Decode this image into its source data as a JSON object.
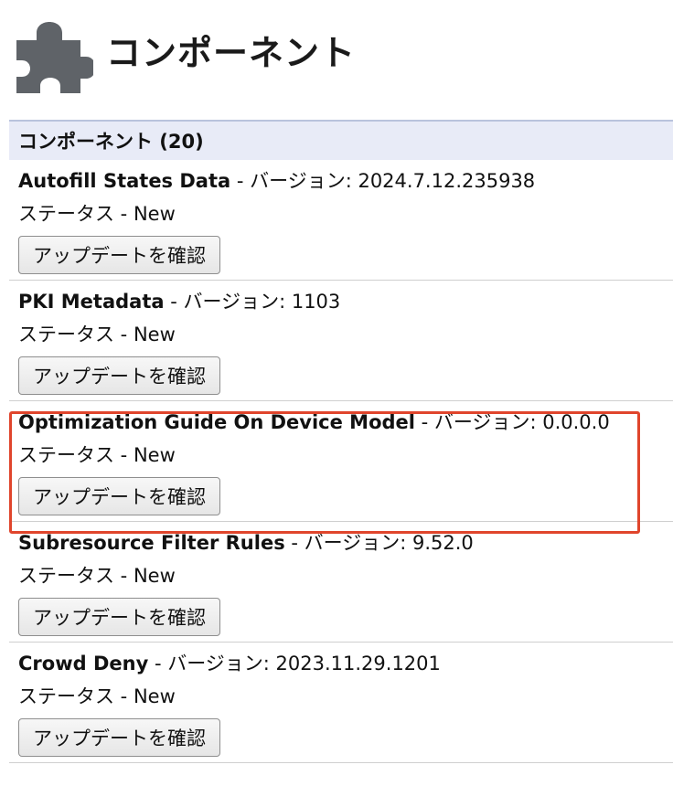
{
  "page": {
    "title": "コンポーネント",
    "icon": "puzzle-piece-icon"
  },
  "section": {
    "header": "コンポーネント (20)"
  },
  "labels": {
    "version_prefix": " - バージョン: ",
    "status_prefix": "ステータス - ",
    "check_button": "アップデートを確認"
  },
  "components": [
    {
      "name": "Autofill States Data",
      "version": "2024.7.12.235938",
      "status": "New"
    },
    {
      "name": "PKI Metadata",
      "version": "1103",
      "status": "New"
    },
    {
      "name": "Optimization Guide On Device Model",
      "version": "0.0.0.0",
      "status": "New",
      "highlighted": true
    },
    {
      "name": "Subresource Filter Rules",
      "version": "9.52.0",
      "status": "New"
    },
    {
      "name": "Crowd Deny",
      "version": "2023.11.29.1201",
      "status": "New"
    }
  ],
  "colors": {
    "section_header_bg": "#e8ebf7",
    "highlight_border": "#e0452c",
    "icon_gray": "#5f6368"
  }
}
